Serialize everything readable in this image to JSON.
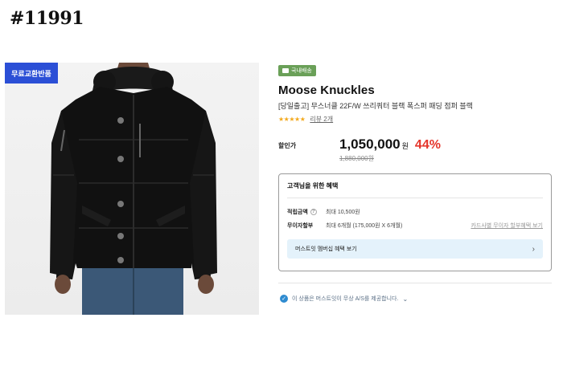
{
  "post_id": "#11991",
  "image_badge": "무료교환반품",
  "shipping_badge": "국내배송",
  "brand": "Moose Knuckles",
  "product_name": "[당일출고] 무스너클 22F/W 쓰리쿼터 블랙 폭스퍼 패딩 점퍼 블랙",
  "rating": {
    "stars": "★★★★★",
    "review_link": "리뷰 2개"
  },
  "price": {
    "label": "할인가",
    "sale": "1,050,000",
    "unit": "원",
    "discount": "44%",
    "original": "1,880,000원"
  },
  "benefits": {
    "title": "고객님을 위한 혜택",
    "points_label": "적립금액",
    "points_value": "최대 10,500원",
    "installment_label": "무이자할부",
    "installment_value": "최대 6개월 (175,000원 X 6개월)",
    "installment_link": "카드사별 무이자 할부혜택 보기",
    "membership": "머스트잇 멤버십 혜택 보기"
  },
  "as_notice": "이 상품은 머스트잇이 무상 A/S를 제공합니다.",
  "colors": {
    "exchange_badge": "#2b4fd6",
    "shipping_badge": "#6aa058",
    "discount": "#e5352b",
    "stars": "#f3a91d",
    "membership_bg": "#e4f2fb",
    "as_check": "#2e8bd0"
  },
  "icons": {
    "question": "question-icon",
    "chevron_right": "chevron-right-icon",
    "check": "check-badge-icon",
    "chevron_down": "chevron-down-icon",
    "truck": "truck-icon"
  }
}
